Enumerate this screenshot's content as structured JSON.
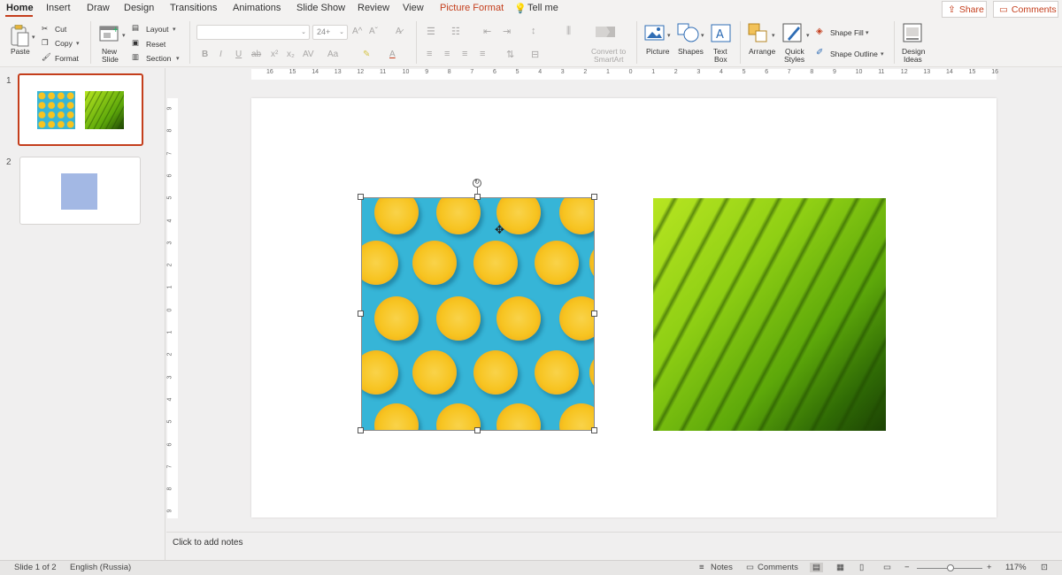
{
  "tabs": {
    "home": "Home",
    "insert": "Insert",
    "draw": "Draw",
    "design": "Design",
    "transitions": "Transitions",
    "animations": "Animations",
    "slide_show": "Slide Show",
    "review": "Review",
    "view": "View",
    "picture_format": "Picture Format",
    "tell_me": "Tell me"
  },
  "header_buttons": {
    "share": "Share",
    "comments": "Comments"
  },
  "ribbon": {
    "paste": "Paste",
    "cut": "Cut",
    "copy": "Copy",
    "format": "Format",
    "new_slide_1": "New",
    "new_slide_2": "Slide",
    "layout": "Layout",
    "reset": "Reset",
    "section": "Section",
    "font_name": "",
    "font_size": "24+",
    "convert_1": "Convert to",
    "convert_2": "SmartArt",
    "picture": "Picture",
    "shapes": "Shapes",
    "text_box_1": "Text",
    "text_box_2": "Box",
    "arrange": "Arrange",
    "quick_styles_1": "Quick",
    "quick_styles_2": "Styles",
    "shape_fill": "Shape Fill",
    "shape_outline": "Shape Outline",
    "design_ideas_1": "Design",
    "design_ideas_2": "Ideas"
  },
  "ruler": {
    "horizontal": [
      "16",
      "15",
      "14",
      "13",
      "12",
      "11",
      "10",
      "9",
      "8",
      "7",
      "6",
      "5",
      "4",
      "3",
      "2",
      "1",
      "0",
      "1",
      "2",
      "3",
      "4",
      "5",
      "6",
      "7",
      "8",
      "9",
      "10",
      "11",
      "12",
      "13",
      "14",
      "15",
      "16"
    ],
    "vertical": [
      "9",
      "8",
      "7",
      "6",
      "5",
      "4",
      "3",
      "2",
      "1",
      "0",
      "1",
      "2",
      "3",
      "4",
      "5",
      "6",
      "7",
      "8",
      "9"
    ]
  },
  "thumbnails": {
    "slide1_num": "1",
    "slide2_num": "2"
  },
  "notes": {
    "placeholder": "Click to add notes"
  },
  "status": {
    "slide_info": "Slide 1 of 2",
    "language": "English (Russia)",
    "notes": "Notes",
    "comments": "Comments",
    "zoom": "117%"
  },
  "colors": {
    "accent": "#c43e1c",
    "lemon_bg": "#36b5d7",
    "thumb2_shape": "#a3b8e4"
  }
}
